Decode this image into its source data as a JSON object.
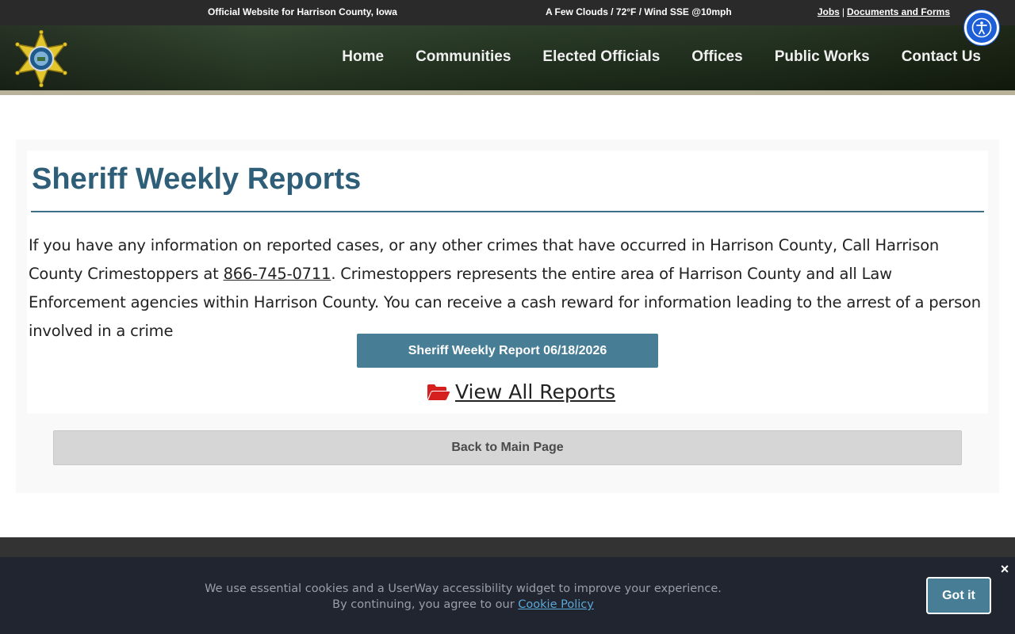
{
  "topbar": {
    "official": "Official Website for Harrison County, Iowa",
    "weather": "A Few Clouds / 72°F / Wind SSE @10mph",
    "links": [
      "Jobs",
      "Documents and Forms"
    ],
    "separator": "|"
  },
  "accessibility": {
    "icon": "accessibility-icon"
  },
  "logo": {
    "icon": "sheriff-star-badge"
  },
  "nav": {
    "items": [
      "Home",
      "Communities",
      "Elected Officials",
      "Offices",
      "Public Works",
      "Contact Us"
    ]
  },
  "main": {
    "title": "Sheriff Weekly Reports",
    "para_before_phone": "If you have any information on reported cases, or any other crimes that have occurred in Harrison County, Call Harrison County Crimestoppers at ",
    "phone": "866-745-0711",
    "para_after_phone": ". Crimestoppers represents the entire area of Harrison County and all Law Enforcement agencies within Harrison County. You can receive a cash reward for information leading to the arrest of a person involved in a crime",
    "report_button": "Sheriff Weekly Report 06/18/2026",
    "view_all": "View All Reports",
    "view_all_icon": "folder-open-icon",
    "back_button": "Back to Main Page"
  },
  "cookie": {
    "line1": "We use essential cookies and a UserWay accessibility widget to improve your experience.",
    "line2_prefix": "By continuing, you agree to our ",
    "policy_link": "Cookie Policy",
    "accept": "Got it",
    "close_icon": "×"
  },
  "colors": {
    "accent": "#487d96",
    "title": "#2e5e78",
    "folder": "#d62020",
    "a11y": "#1d5fd6"
  }
}
